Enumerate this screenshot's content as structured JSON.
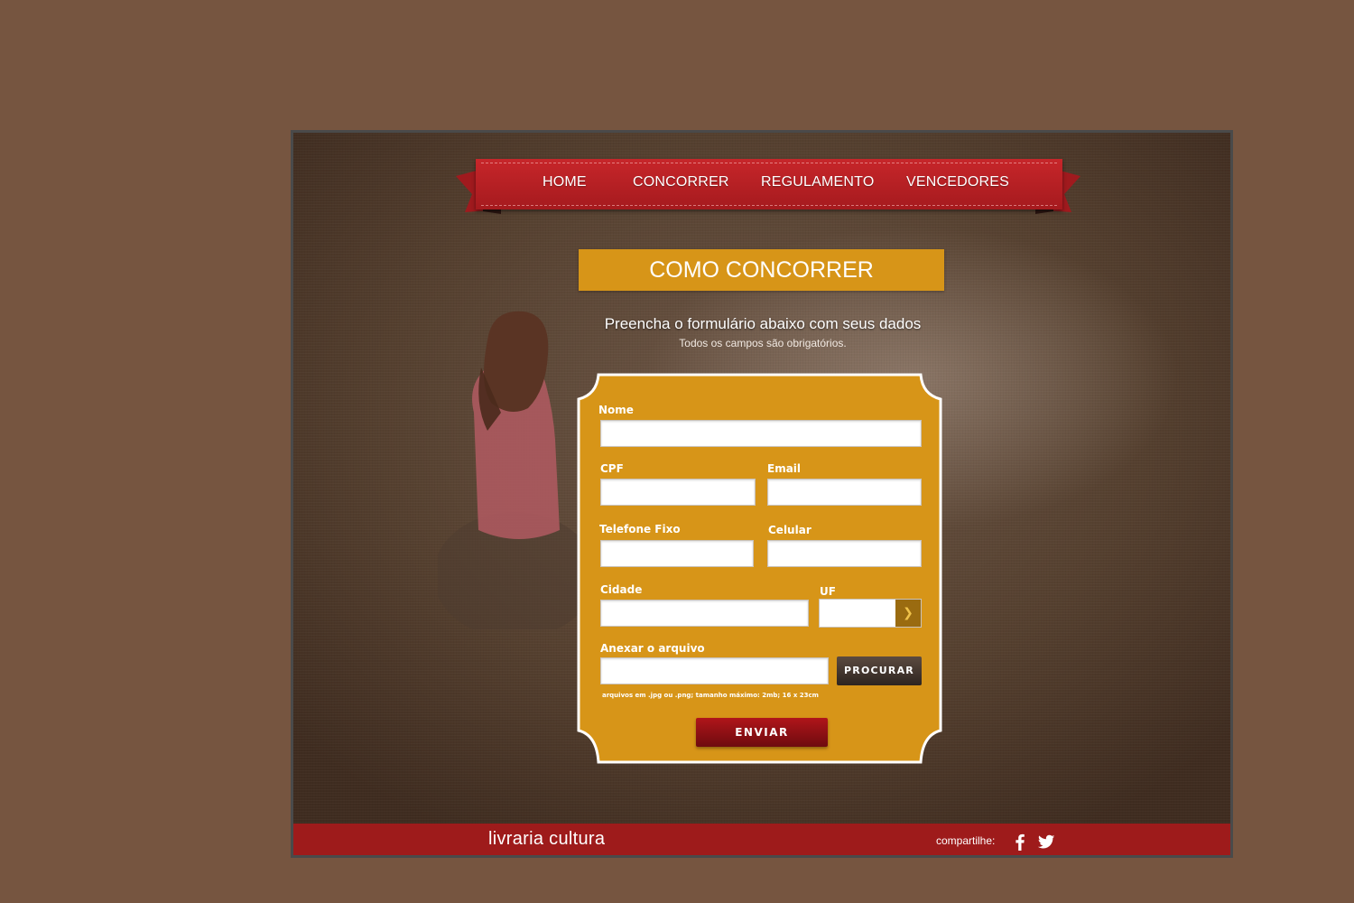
{
  "nav": {
    "items": [
      {
        "label": "HOME"
      },
      {
        "label": "CONCORRER"
      },
      {
        "label": "REGULAMENTO"
      },
      {
        "label": "VENCEDORES"
      }
    ]
  },
  "header": {
    "title": "COMO CONCORRER",
    "subtitle": "Preencha o formulário abaixo com seus dados",
    "note": "Todos os campos são obrigatórios."
  },
  "form": {
    "fields": {
      "nome": {
        "label": "Nome",
        "value": ""
      },
      "cpf": {
        "label": "CPF",
        "value": ""
      },
      "email": {
        "label": "Email",
        "value": ""
      },
      "telefone": {
        "label": "Telefone Fixo",
        "value": ""
      },
      "celular": {
        "label": "Celular",
        "value": ""
      },
      "cidade": {
        "label": "Cidade",
        "value": ""
      },
      "uf": {
        "label": "UF",
        "value": ""
      },
      "arquivo": {
        "label": "Anexar o arquivo",
        "value": ""
      }
    },
    "browse_label": "PROCURAR",
    "file_hint": "arquivos em .jpg ou .png; tamanho máximo: 2mb; 16 x 23cm",
    "submit_label": "ENVIAR"
  },
  "footer": {
    "brand": "livraria cultura",
    "share_label": "compartilhe:",
    "social": [
      {
        "icon": "facebook-icon"
      },
      {
        "icon": "twitter-icon"
      }
    ]
  },
  "colors": {
    "page_bg": "#765540",
    "ribbon_red": "#b81f24",
    "gold": "#d79518",
    "footer_red": "#9e1b1b",
    "submit_red": "#8e1015",
    "browse_dark": "#3b2f28"
  }
}
